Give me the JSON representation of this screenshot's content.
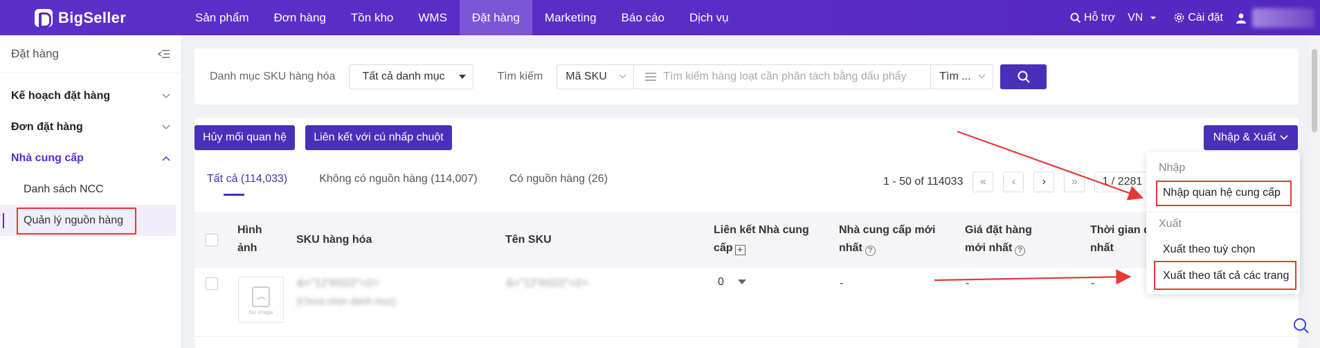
{
  "brand": {
    "name": "BigSeller",
    "accent": "#5a2bc6",
    "button": "#4a2fb8",
    "annotation_red": "#e53935"
  },
  "nav": {
    "items": [
      "Sản phẩm",
      "Đơn hàng",
      "Tồn kho",
      "WMS",
      "Đặt hàng",
      "Marketing",
      "Báo cáo",
      "Dịch vụ"
    ],
    "active_index": 4
  },
  "topright": {
    "support": "Hỗ trợ",
    "language": "VN",
    "settings": "Cài đặt"
  },
  "sidebar": {
    "title": "Đặt hàng",
    "groups": [
      {
        "label": "Kế hoạch đặt hàng",
        "open": false
      },
      {
        "label": "Đơn đặt hàng",
        "open": false
      },
      {
        "label": "Nhà cung cấp",
        "open": true
      }
    ],
    "sub_items": [
      "Danh sách NCC",
      "Quản lý nguồn hàng"
    ]
  },
  "filter": {
    "category_label": "Danh mục SKU hàng hóa",
    "category_value": "Tất cả danh mục",
    "search_label": "Tìm kiếm",
    "search_field": "Mã SKU",
    "search_placeholder": "Tìm kiếm hàng loạt cần phân tách bằng dấu phẩy",
    "search_mode": "Tìm ..."
  },
  "actions": {
    "unlink": "Hủy mối quan hệ",
    "link_click": "Liên kết với cú nhấp chuột",
    "import_export": "Nhập & Xuất"
  },
  "tabs": [
    "Tất cả (114,033)",
    "Không có nguồn hàng (114,007)",
    "Có nguồn hàng (26)"
  ],
  "pager": {
    "range": "1 - 50 of 114033",
    "page": "1 / 2281"
  },
  "table": {
    "headers": {
      "image": "Hình ảnh",
      "sku": "SKU hàng hóa",
      "sku_name": "Tên SKU",
      "supplier_link": "Liên kết Nhà cung cấp",
      "latest_supplier": "Nhà cung cấp mới nhất",
      "latest_price": "Giá đặt hàng mới nhất",
      "latest_time": "Thời gian đặt mới nhất"
    },
    "row": {
      "no_image": "No Image",
      "sku_blur": "&<\"12'®022\">2>",
      "category_blur": "[Chưa chọn danh mục]",
      "name_blur": "&<\"12'®022\">2>",
      "supplier_count": "0",
      "latest_supplier": "-",
      "latest_price": "-",
      "latest_time": "-"
    }
  },
  "dropdown": {
    "import_label": "Nhập",
    "import_item": "Nhập quan hệ cung cấp",
    "export_label": "Xuất",
    "export_custom": "Xuất theo tuỳ chọn",
    "export_all": "Xuất theo tất cả các trang"
  }
}
